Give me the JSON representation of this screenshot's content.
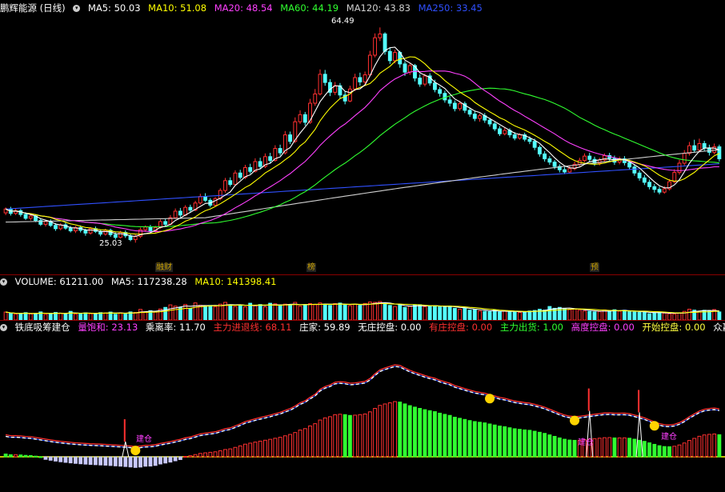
{
  "main_legend": {
    "title": "鹏辉能源 (日线)",
    "ma5": "MA5: 50.03",
    "ma10": "MA10: 51.08",
    "ma20": "MA20: 48.54",
    "ma60": "MA60: 44.19",
    "ma120": "MA120: 43.83",
    "ma250": "MA250: 33.45"
  },
  "price_labels": {
    "high": "64.49",
    "low": "25.03"
  },
  "event_tags": [
    "融财",
    "榜",
    "预"
  ],
  "volume_legend": {
    "volume": "VOLUME: 61211.00",
    "ma5": "MA5: 117238.28",
    "ma10": "MA10: 141398.41"
  },
  "indicator_legend": {
    "name": "铁底吸筹建仓",
    "items": [
      {
        "label": "量饱和: 23.13",
        "color": "#ff40ff"
      },
      {
        "label": "乘离率: 11.70",
        "color": "#ffffff"
      },
      {
        "label": "主力进退线: 68.11",
        "color": "#ff3030"
      },
      {
        "label": "庄家: 59.89",
        "color": "#ffffff"
      },
      {
        "label": "无庄控盘: 0.00",
        "color": "#ffffff"
      },
      {
        "label": "有庄控盘: 0.00",
        "color": "#ff3030"
      },
      {
        "label": "主力出货: 1.00",
        "color": "#30ff30"
      },
      {
        "label": "高度控盘: 0.00",
        "color": "#ff40ff"
      },
      {
        "label": "开始控盘: 0.00",
        "color": "#ffff40"
      },
      {
        "label": "众赢一",
        "color": "#ffffff"
      }
    ]
  },
  "indicator_marks": {
    "build1": "建仓",
    "build2": "建仓",
    "build3": "建仓"
  },
  "colors": {
    "up": "#ff3030",
    "down": "#54ffff",
    "ma5": "#ffffff",
    "ma10": "#ffff00",
    "ma20": "#ff40ff",
    "ma60": "#30ff30",
    "ma120": "#d0d0d0",
    "ma250": "#3050ff"
  },
  "chart_data": {
    "type": "candlestick",
    "price_range": [
      22,
      66
    ],
    "candles": [
      [
        30.5,
        31.2,
        31.5,
        30.1
      ],
      [
        31.2,
        30.4,
        31.6,
        30.0
      ],
      [
        30.4,
        30.9,
        31.3,
        30.1
      ],
      [
        30.9,
        30.2,
        31.2,
        29.8
      ],
      [
        30.2,
        29.5,
        30.6,
        29.2
      ],
      [
        29.5,
        29.9,
        30.3,
        29.1
      ],
      [
        29.9,
        29.1,
        30.1,
        28.8
      ],
      [
        29.1,
        28.4,
        29.5,
        28.1
      ],
      [
        28.4,
        28.9,
        29.2,
        28.0
      ],
      [
        28.9,
        28.2,
        29.3,
        27.9
      ],
      [
        28.2,
        27.6,
        28.6,
        27.2
      ],
      [
        27.6,
        28.3,
        28.6,
        27.3
      ],
      [
        28.3,
        27.7,
        28.7,
        27.4
      ],
      [
        27.7,
        27.2,
        28.1,
        26.9
      ],
      [
        27.2,
        27.8,
        28.1,
        26.8
      ],
      [
        27.8,
        27.3,
        28.2,
        26.9
      ],
      [
        27.3,
        26.8,
        27.6,
        26.3
      ],
      [
        26.8,
        27.6,
        27.9,
        26.5
      ],
      [
        27.6,
        27.1,
        28.0,
        26.8
      ],
      [
        27.1,
        26.6,
        27.4,
        26.2
      ],
      [
        26.6,
        27.3,
        27.6,
        26.3
      ],
      [
        27.3,
        26.5,
        27.6,
        26.1
      ],
      [
        26.5,
        26.0,
        26.9,
        25.6
      ],
      [
        26.0,
        26.9,
        27.2,
        25.8
      ],
      [
        26.9,
        26.3,
        27.3,
        25.9
      ],
      [
        26.3,
        25.6,
        26.7,
        25.3
      ],
      [
        25.6,
        26.2,
        26.5,
        25.03
      ],
      [
        26.2,
        27.4,
        27.8,
        25.9
      ],
      [
        27.4,
        27.9,
        28.2,
        27.0
      ],
      [
        27.9,
        27.2,
        28.3,
        26.9
      ],
      [
        27.2,
        27.8,
        28.1,
        26.9
      ],
      [
        27.8,
        28.9,
        29.3,
        27.6
      ],
      [
        28.9,
        28.4,
        29.4,
        28.0
      ],
      [
        28.4,
        29.6,
        30.1,
        28.2
      ],
      [
        29.6,
        30.8,
        31.3,
        29.4
      ],
      [
        30.8,
        30.1,
        31.4,
        29.7
      ],
      [
        30.1,
        31.5,
        31.9,
        29.9
      ],
      [
        31.5,
        31.0,
        32.0,
        30.6
      ],
      [
        31.0,
        32.3,
        32.7,
        30.8
      ],
      [
        32.3,
        33.5,
        34.0,
        32.0
      ],
      [
        33.5,
        32.8,
        34.1,
        32.5
      ],
      [
        32.8,
        31.9,
        33.2,
        31.5
      ],
      [
        31.9,
        33.1,
        33.4,
        31.6
      ],
      [
        33.1,
        34.6,
        35.0,
        32.8
      ],
      [
        34.6,
        36.4,
        36.9,
        34.2
      ],
      [
        36.4,
        35.7,
        37.0,
        35.3
      ],
      [
        35.7,
        37.8,
        38.3,
        35.5
      ],
      [
        37.8,
        37.0,
        38.4,
        36.6
      ],
      [
        37.0,
        38.8,
        39.3,
        36.7
      ],
      [
        38.8,
        38.1,
        39.5,
        37.7
      ],
      [
        38.1,
        39.9,
        40.5,
        37.9
      ],
      [
        39.9,
        39.0,
        40.6,
        38.6
      ],
      [
        39.0,
        40.8,
        41.4,
        38.7
      ],
      [
        40.8,
        40.1,
        41.5,
        39.6
      ],
      [
        40.1,
        42.3,
        42.9,
        39.9
      ],
      [
        42.3,
        41.5,
        43.0,
        41.0
      ],
      [
        41.5,
        44.8,
        45.5,
        41.2
      ],
      [
        44.8,
        43.6,
        45.4,
        43.1
      ],
      [
        43.6,
        47.2,
        48.0,
        43.3
      ],
      [
        47.2,
        48.5,
        49.3,
        46.8
      ],
      [
        48.5,
        47.1,
        49.0,
        46.5
      ],
      [
        47.1,
        50.6,
        51.4,
        46.8
      ],
      [
        50.6,
        52.3,
        53.2,
        50.1
      ],
      [
        52.3,
        55.9,
        56.8,
        52.0
      ],
      [
        55.9,
        54.4,
        56.7,
        53.8
      ],
      [
        54.4,
        52.6,
        55.0,
        51.9
      ],
      [
        52.6,
        53.8,
        54.5,
        52.1
      ],
      [
        53.8,
        52.1,
        54.3,
        51.5
      ],
      [
        52.1,
        51.0,
        52.8,
        50.4
      ],
      [
        51.0,
        53.2,
        53.8,
        50.8
      ],
      [
        53.2,
        55.3,
        56.0,
        52.8
      ],
      [
        55.3,
        54.5,
        56.2,
        53.8
      ],
      [
        54.5,
        55.8,
        56.4,
        54.0
      ],
      [
        55.8,
        59.4,
        60.2,
        55.5
      ],
      [
        59.4,
        62.6,
        63.4,
        59.0
      ],
      [
        62.6,
        63.3,
        64.49,
        62.0
      ],
      [
        63.3,
        60.1,
        63.6,
        59.5
      ],
      [
        60.1,
        58.4,
        60.8,
        57.8
      ],
      [
        58.4,
        59.9,
        60.4,
        57.9
      ],
      [
        59.9,
        57.8,
        60.2,
        57.1
      ],
      [
        57.8,
        56.3,
        58.3,
        55.6
      ],
      [
        56.3,
        57.5,
        57.9,
        55.8
      ],
      [
        57.5,
        55.2,
        57.8,
        54.6
      ],
      [
        55.2,
        54.1,
        55.9,
        53.6
      ],
      [
        54.1,
        55.6,
        56.0,
        53.7
      ],
      [
        55.6,
        54.3,
        56.1,
        53.8
      ],
      [
        54.3,
        53.1,
        54.9,
        52.6
      ],
      [
        53.1,
        52.4,
        53.6,
        51.8
      ],
      [
        52.4,
        51.2,
        52.9,
        50.7
      ],
      [
        51.2,
        50.6,
        51.8,
        50.0
      ],
      [
        50.6,
        49.6,
        51.1,
        49.1
      ],
      [
        49.6,
        50.5,
        51.0,
        49.2
      ],
      [
        50.5,
        49.3,
        50.9,
        48.8
      ],
      [
        49.3,
        48.6,
        49.8,
        48.1
      ],
      [
        48.6,
        47.8,
        49.1,
        47.3
      ],
      [
        47.8,
        48.3,
        48.7,
        47.2
      ],
      [
        48.3,
        47.5,
        48.8,
        47.0
      ],
      [
        47.5,
        46.8,
        47.9,
        46.3
      ],
      [
        46.8,
        45.9,
        47.2,
        45.5
      ],
      [
        45.9,
        45.0,
        46.4,
        44.6
      ],
      [
        45.0,
        45.6,
        46.1,
        44.7
      ],
      [
        45.6,
        44.8,
        46.0,
        44.3
      ],
      [
        44.8,
        44.2,
        45.3,
        43.8
      ],
      [
        44.2,
        44.8,
        45.1,
        43.9
      ],
      [
        44.8,
        44.0,
        45.2,
        43.6
      ],
      [
        44.0,
        43.6,
        44.5,
        43.1
      ],
      [
        43.6,
        42.5,
        44.1,
        42.0
      ],
      [
        42.5,
        41.3,
        42.9,
        40.8
      ],
      [
        41.3,
        40.4,
        41.8,
        39.9
      ],
      [
        40.4,
        39.8,
        40.9,
        39.3
      ],
      [
        39.8,
        39.0,
        40.2,
        38.5
      ],
      [
        39.0,
        38.4,
        39.4,
        37.9
      ],
      [
        38.4,
        38.0,
        38.9,
        37.6
      ],
      [
        38.0,
        38.6,
        39.1,
        37.7
      ],
      [
        38.6,
        39.4,
        39.9,
        38.3
      ],
      [
        39.4,
        40.1,
        40.6,
        39.0
      ],
      [
        40.1,
        40.9,
        41.4,
        39.8
      ],
      [
        40.9,
        40.3,
        41.5,
        39.9
      ],
      [
        40.3,
        39.6,
        40.8,
        39.1
      ],
      [
        39.6,
        40.2,
        40.6,
        39.2
      ],
      [
        40.2,
        41.0,
        41.4,
        39.9
      ],
      [
        41.0,
        40.5,
        41.5,
        40.0
      ],
      [
        40.5,
        39.8,
        41.0,
        39.3
      ],
      [
        39.8,
        40.4,
        40.8,
        39.4
      ],
      [
        40.4,
        39.7,
        40.9,
        39.2
      ],
      [
        39.7,
        38.9,
        40.2,
        38.4
      ],
      [
        38.9,
        37.8,
        39.4,
        37.3
      ],
      [
        37.8,
        36.9,
        38.3,
        36.4
      ],
      [
        36.9,
        36.1,
        37.4,
        35.6
      ],
      [
        36.1,
        35.3,
        36.6,
        34.8
      ],
      [
        35.3,
        34.8,
        35.8,
        34.2
      ],
      [
        34.8,
        34.3,
        35.3,
        33.9
      ],
      [
        34.3,
        34.9,
        35.4,
        34.0
      ],
      [
        34.9,
        36.2,
        36.7,
        34.6
      ],
      [
        36.2,
        37.9,
        38.5,
        35.9
      ],
      [
        37.9,
        39.6,
        40.2,
        37.5
      ],
      [
        39.6,
        41.4,
        42.0,
        39.2
      ],
      [
        41.4,
        42.8,
        43.5,
        41.0
      ],
      [
        42.8,
        42.0,
        43.9,
        41.5
      ],
      [
        42.0,
        43.2,
        44.1,
        41.6
      ],
      [
        43.2,
        42.4,
        43.7,
        41.8
      ],
      [
        42.4,
        41.6,
        43.0,
        41.0
      ],
      [
        41.6,
        42.6,
        43.2,
        41.2
      ],
      [
        42.6,
        40.4,
        43.0,
        39.9
      ]
    ],
    "volume_range": [
      0,
      320000
    ],
    "volume": [
      88000,
      72000,
      65000,
      70000,
      82000,
      68000,
      74000,
      90000,
      62000,
      70000,
      84000,
      76000,
      70000,
      96000,
      66000,
      70000,
      80000,
      70000,
      74000,
      82000,
      78000,
      88000,
      64000,
      80000,
      72000,
      90000,
      84000,
      118000,
      92000,
      104000,
      88000,
      122000,
      140000,
      168000,
      154000,
      142000,
      172000,
      128000,
      190000,
      164000,
      150000,
      162000,
      148000,
      176000,
      196000,
      170000,
      150000,
      162000,
      146000,
      186000,
      158000,
      172000,
      146000,
      186000,
      180000,
      160000,
      176000,
      168000,
      196000,
      154000,
      168000,
      182000,
      170000,
      190000,
      176000,
      162000,
      182000,
      188000,
      172000,
      160000,
      176000,
      162000,
      184000,
      200000,
      196000,
      205000,
      178000,
      162000,
      150000,
      168000,
      140000,
      152000,
      166000,
      170000,
      148000,
      158000,
      160000,
      146000,
      146000,
      156000,
      130000,
      120000,
      128000,
      110000,
      118000,
      100000,
      96000,
      92000,
      112000,
      90000,
      98000,
      88000,
      96000,
      84000,
      92000,
      100000,
      106000,
      120000,
      110000,
      150000,
      130000,
      140000,
      124000,
      116000,
      122000,
      108000,
      100000,
      96000,
      90000,
      94000,
      112000,
      104000,
      114000,
      98000,
      108000,
      92000,
      88000,
      84000,
      92000,
      70000,
      80000,
      88000,
      76000,
      70000,
      66000,
      80000,
      96000,
      120000,
      110000,
      90000,
      108000,
      100000,
      116000,
      90000
    ],
    "indicator_range": [
      -40,
      150
    ]
  }
}
